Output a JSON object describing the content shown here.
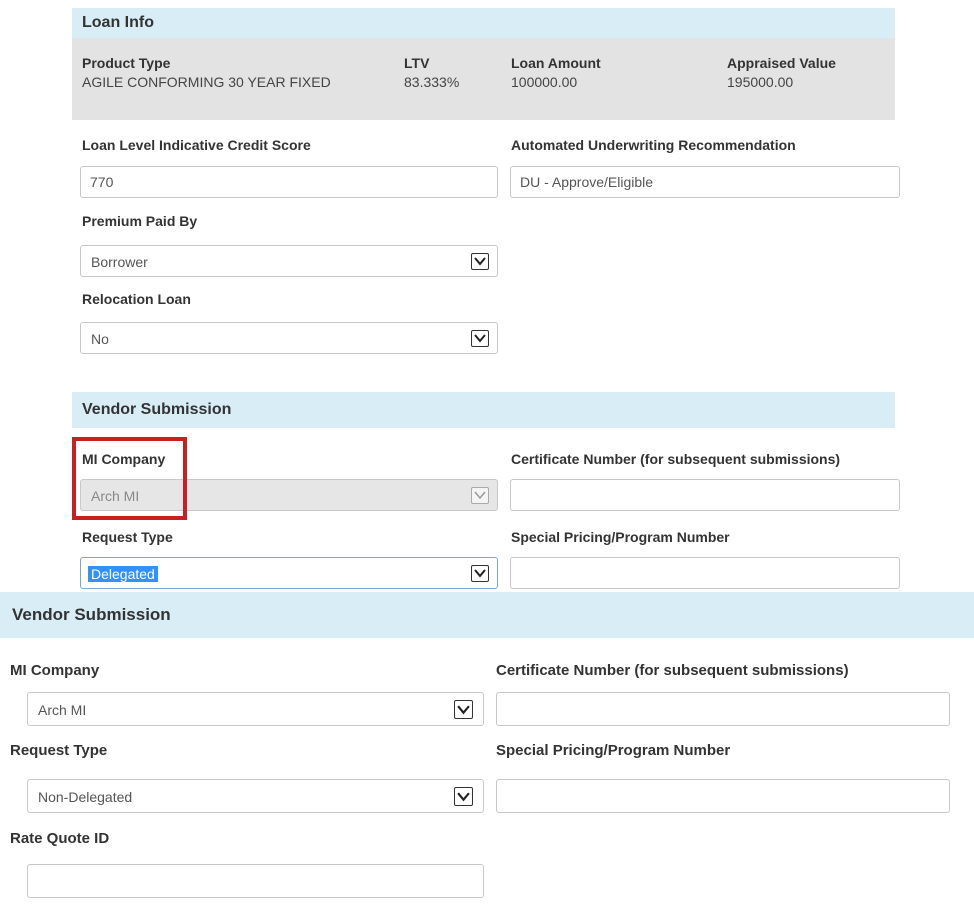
{
  "loan_info": {
    "title": "Loan Info",
    "product_type_label": "Product Type",
    "product_type_value": "AGILE CONFORMING 30 YEAR FIXED",
    "ltv_label": "LTV",
    "ltv_value": "83.333%",
    "loan_amount_label": "Loan Amount",
    "loan_amount_value": "100000.00",
    "appraised_value_label": "Appraised Value",
    "appraised_value_value": "195000.00",
    "credit_score_label": "Loan Level Indicative Credit Score",
    "credit_score_value": "770",
    "au_recommendation_label": "Automated Underwriting Recommendation",
    "au_recommendation_value": "DU - Approve/Eligible",
    "premium_paid_by_label": "Premium Paid By",
    "premium_paid_by_value": "Borrower",
    "relocation_loan_label": "Relocation Loan",
    "relocation_loan_value": "No"
  },
  "vendor_submission_top": {
    "title": "Vendor Submission",
    "mi_company_label": "MI Company",
    "mi_company_value": "Arch MI",
    "certificate_label": "Certificate Number (for subsequent submissions)",
    "certificate_value": "",
    "request_type_label": "Request Type",
    "request_type_value": "Delegated",
    "special_pricing_label": "Special Pricing/Program Number",
    "special_pricing_value": ""
  },
  "vendor_submission_bottom": {
    "title": "Vendor Submission",
    "mi_company_label": "MI Company",
    "mi_company_value": "Arch MI",
    "certificate_label": "Certificate Number (for subsequent submissions)",
    "certificate_value": "",
    "request_type_label": "Request Type",
    "request_type_value": "Non-Delegated",
    "special_pricing_label": "Special Pricing/Program Number",
    "special_pricing_value": "",
    "rate_quote_label": "Rate Quote ID",
    "rate_quote_value": ""
  },
  "icons": {
    "dropdown": "chevron-down-icon"
  },
  "colors": {
    "section_header_bg": "#d9edf7",
    "info_strip_bg": "#e3e3e3",
    "highlight_border": "#c62020",
    "selection_bg": "#3390ff"
  }
}
